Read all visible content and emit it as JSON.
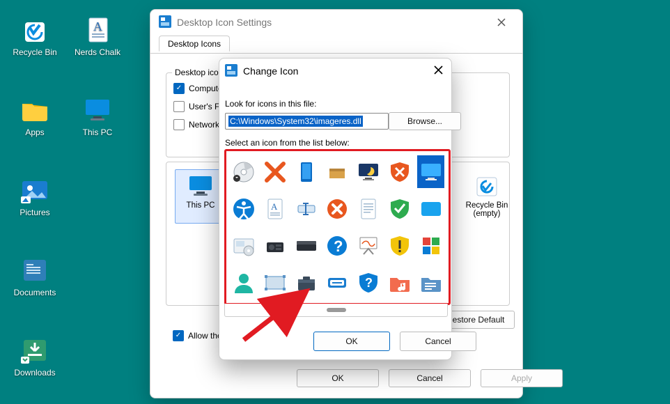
{
  "desktop": {
    "items": [
      {
        "label": "Recycle Bin",
        "icon": "recycle-bin"
      },
      {
        "label": "Nerds Chalk",
        "icon": "text-doc"
      },
      {
        "label": "Apps",
        "icon": "folder"
      },
      {
        "label": "This PC",
        "icon": "monitor"
      },
      {
        "label": "Pictures",
        "icon": "pictures"
      },
      {
        "label": "Documents",
        "icon": "documents"
      },
      {
        "label": "Downloads",
        "icon": "downloads"
      }
    ]
  },
  "parentDialog": {
    "title": "Desktop Icon Settings",
    "tab": "Desktop Icons",
    "group": "Desktop icons",
    "checks": [
      {
        "label": "Computer",
        "checked": true
      },
      {
        "label": "User's Files",
        "checked": false
      },
      {
        "label": "Network",
        "checked": false
      }
    ],
    "well": [
      {
        "label": "This PC"
      },
      {
        "label": "Recycle Bin\n(empty)"
      }
    ],
    "restoreDefault": "Restore Default",
    "allowThemes": "Allow themes to change desktop icons",
    "allowChecked": true,
    "buttons": {
      "ok": "OK",
      "cancel": "Cancel",
      "apply": "Apply"
    }
  },
  "childDialog": {
    "title": "Change Icon",
    "lookLabel": "Look for icons in this file:",
    "path": "C:\\Windows\\System32\\imageres.dll",
    "browse": "Browse...",
    "selectLabel": "Select an icon from the list below:",
    "icons": [
      [
        "cd",
        "x-orange",
        "tablet",
        "box",
        "moon-monitor",
        "shield-x",
        "monitor-sel"
      ],
      [
        "accessibility",
        "page-a",
        "text-cursor",
        "x-circle",
        "page",
        "shield-check",
        "desktop-blue"
      ],
      [
        "media-drive",
        "hifi",
        "scanner",
        "help",
        "whiteboard",
        "shield-warn",
        "blocks"
      ],
      [
        "user",
        "frame",
        "briefcase",
        "run",
        "shield-help",
        "folder-music",
        "folder-docs"
      ]
    ],
    "selected": {
      "row": 0,
      "col": 6
    },
    "buttons": {
      "ok": "OK",
      "cancel": "Cancel"
    }
  }
}
